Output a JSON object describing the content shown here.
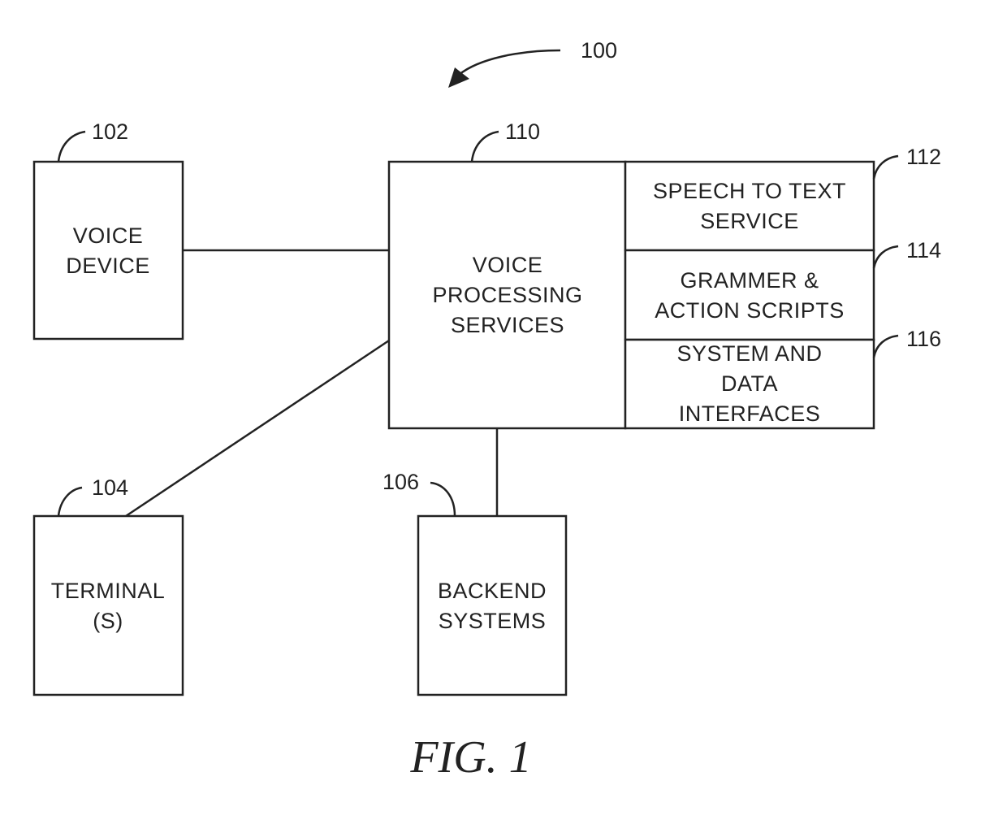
{
  "figure": {
    "caption": "FIG. 1",
    "system_ref": "100"
  },
  "nodes": {
    "voice_device": {
      "ref": "102",
      "lines": [
        "VOICE",
        "DEVICE"
      ]
    },
    "terminal": {
      "ref": "104",
      "lines": [
        "TERMINAL",
        "(S)"
      ]
    },
    "backend": {
      "ref": "106",
      "lines": [
        "BACKEND",
        "SYSTEMS"
      ]
    },
    "voice_processing": {
      "ref": "110",
      "lines": [
        "VOICE",
        "PROCESSING",
        "SERVICES"
      ]
    },
    "speech_to_text": {
      "ref": "112",
      "lines": [
        "SPEECH TO TEXT",
        "SERVICE"
      ]
    },
    "grammar": {
      "ref": "114",
      "lines": [
        "GRAMMER &",
        "ACTION SCRIPTS"
      ]
    },
    "interfaces": {
      "ref": "116",
      "lines": [
        "SYSTEM AND",
        "DATA",
        "INTERFACES"
      ]
    }
  },
  "edges": [
    {
      "from": "voice_device",
      "to": "voice_processing"
    },
    {
      "from": "terminal",
      "to": "voice_processing"
    },
    {
      "from": "backend",
      "to": "voice_processing"
    }
  ],
  "colors": {
    "ink": "#222222",
    "background": "#ffffff"
  }
}
